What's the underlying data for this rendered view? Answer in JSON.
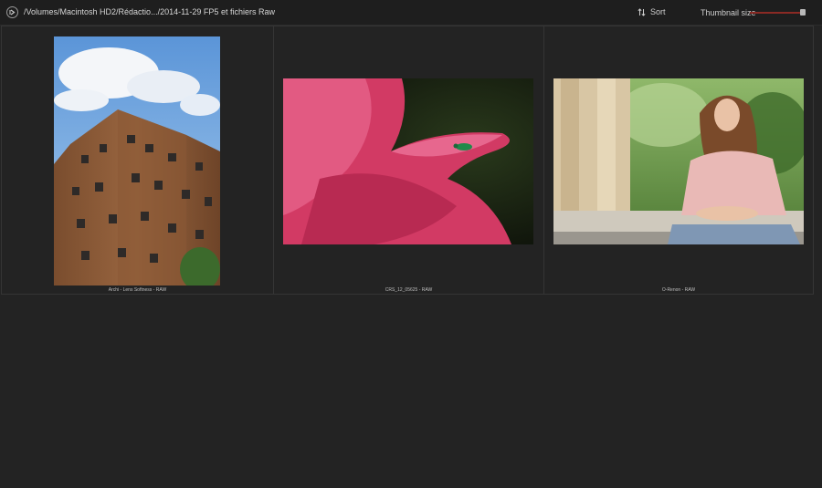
{
  "window": {
    "path": "/Volumes/Macintosh HD2/Rédactio.../2014-11-29 FP5 et fichiers Raw"
  },
  "toolbar": {
    "sort_label": "Sort",
    "thumbnail_size_label": "Thumbnail size",
    "thumbnail_size_value": 0.95
  },
  "icons": {
    "back": "back-circle-icon",
    "sort": "sort-arrows-icon"
  },
  "colors": {
    "background": "#232323",
    "topbar": "#1e1e1e",
    "slider_accent": "#8a2a24"
  },
  "thumbnails": [
    {
      "caption": "Archi - Lens Softness - RAW",
      "subject": "building"
    },
    {
      "caption": "CRS_12_05625 - RAW",
      "subject": "rose-insect"
    },
    {
      "caption": "O-Renon - RAW",
      "subject": "portrait-woman"
    }
  ]
}
